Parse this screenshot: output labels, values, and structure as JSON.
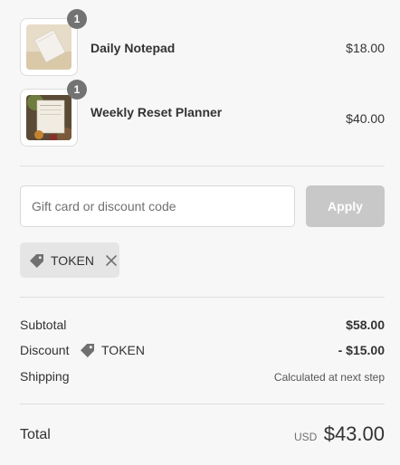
{
  "products": [
    {
      "name": "Daily Notepad",
      "price": "$18.00",
      "quantity": "1"
    },
    {
      "name": "Weekly Reset Planner",
      "price": "$40.00",
      "quantity": "1"
    }
  ],
  "discount": {
    "placeholder": "Gift card or discount code",
    "apply_label": "Apply",
    "applied_code": "TOKEN",
    "tag_icon": "tag-icon",
    "remove_icon": "close-icon"
  },
  "summary": {
    "subtotal_label": "Subtotal",
    "subtotal_value": "$58.00",
    "discount_label": "Discount",
    "discount_code": "TOKEN",
    "discount_value": "- $15.00",
    "shipping_label": "Shipping",
    "shipping_value": "Calculated at next step",
    "total_label": "Total",
    "currency": "USD",
    "total_value": "$43.00"
  },
  "colors": {
    "background": "#f7f7f7",
    "badge": "#737373",
    "apply_disabled": "#c8c8c8",
    "chip": "#e5e5e5"
  }
}
